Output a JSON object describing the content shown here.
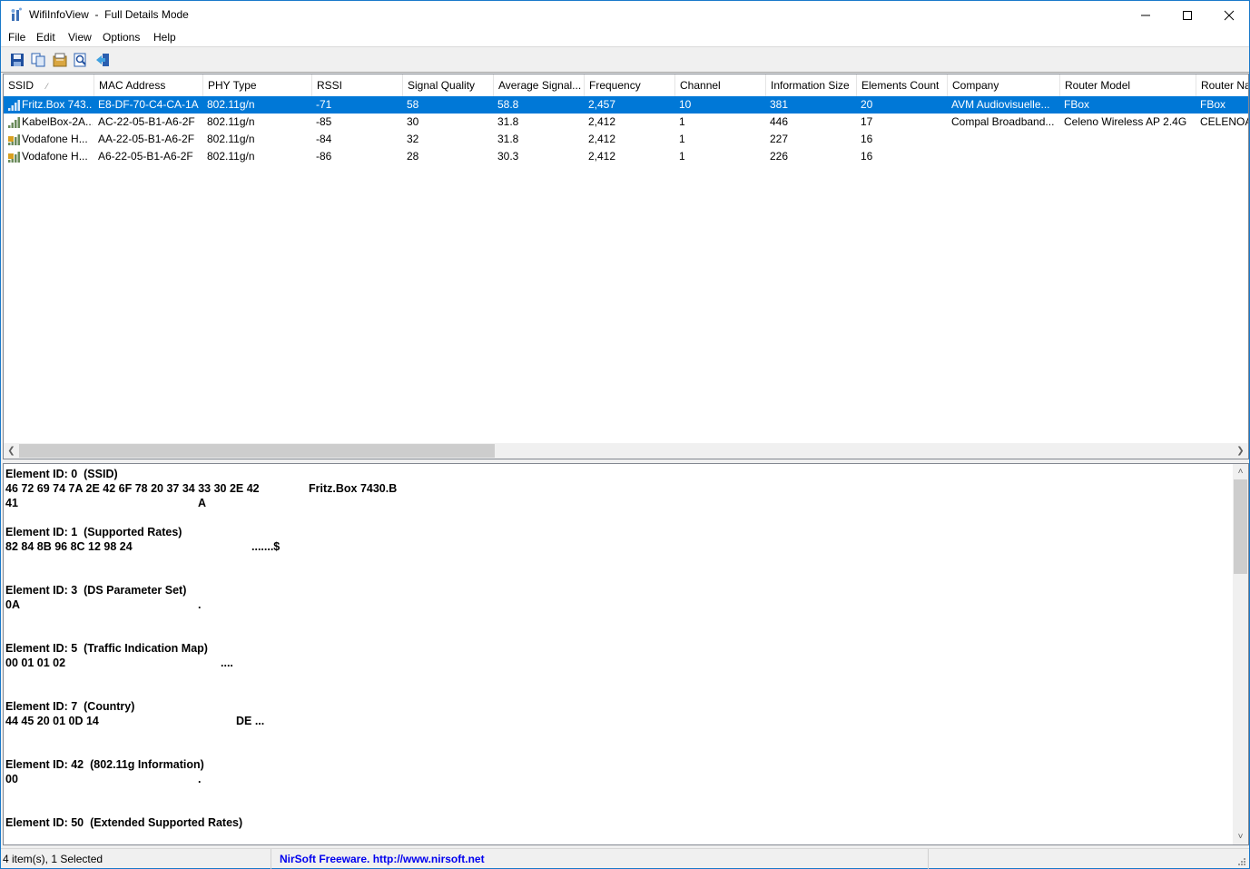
{
  "window": {
    "app_name": "WifiInfoView",
    "title_sep": "-",
    "mode": "Full Details Mode"
  },
  "menu": [
    "File",
    "Edit",
    "View",
    "Options",
    "Help"
  ],
  "toolbar": {
    "icons": [
      "save-icon",
      "copy-icon",
      "properties-icon",
      "find-icon",
      "exit-icon"
    ]
  },
  "columns": [
    "SSID",
    "MAC Address",
    "PHY Type",
    "RSSI",
    "Signal Quality",
    "Average Signal...",
    "Frequency",
    "Channel",
    "Information Size",
    "Elements Count",
    "Company",
    "Router Model",
    "Router Na"
  ],
  "rows": [
    {
      "ssid": "Fritz.Box 743...",
      "mac": "E8-DF-70-C4-CA-1A",
      "phy": "802.11g/n",
      "rssi": "-71",
      "quality": "58",
      "avg": "58.8",
      "freq": "2,457",
      "channel": "10",
      "info_size": "381",
      "elements": "20",
      "company": "AVM Audiovisuelle...",
      "model": "FBox",
      "router_name": "FBox",
      "icon": "signal-icon",
      "selected": true
    },
    {
      "ssid": "KabelBox-2A...",
      "mac": "AC-22-05-B1-A6-2F",
      "phy": "802.11g/n",
      "rssi": "-85",
      "quality": "30",
      "avg": "31.8",
      "freq": "2,412",
      "channel": "1",
      "info_size": "446",
      "elements": "17",
      "company": "Compal Broadband...",
      "model": "Celeno Wireless AP 2.4G",
      "router_name": "CELENOA",
      "icon": "signal-icon",
      "selected": false
    },
    {
      "ssid": "Vodafone H...",
      "mac": "AA-22-05-B1-A6-2F",
      "phy": "802.11g/n",
      "rssi": "-84",
      "quality": "32",
      "avg": "31.8",
      "freq": "2,412",
      "channel": "1",
      "info_size": "227",
      "elements": "16",
      "company": "",
      "model": "",
      "router_name": "",
      "icon": "locked-signal-icon",
      "selected": false
    },
    {
      "ssid": "Vodafone H...",
      "mac": "A6-22-05-B1-A6-2F",
      "phy": "802.11g/n",
      "rssi": "-86",
      "quality": "28",
      "avg": "30.3",
      "freq": "2,412",
      "channel": "1",
      "info_size": "226",
      "elements": "16",
      "company": "",
      "model": "",
      "router_name": "",
      "icon": "locked-signal-icon",
      "selected": false
    }
  ],
  "details": [
    {
      "header": "Element ID: 0  (SSID)",
      "hex": [
        "46 72 69 74 7A 2E 42 6F 78 20 37 34 33 30 2E 42",
        "41"
      ],
      "ascii": [
        "Fritz.Box 7430.B",
        "A"
      ]
    },
    {
      "header": "Element ID: 1  (Supported Rates)",
      "hex": [
        "82 84 8B 96 8C 12 98 24"
      ],
      "ascii": [
        ".......$"
      ]
    },
    {
      "header": "Element ID: 3  (DS Parameter Set)",
      "hex": [
        "0A"
      ],
      "ascii": [
        "."
      ]
    },
    {
      "header": "Element ID: 5  (Traffic Indication Map)",
      "hex": [
        "00 01 01 02"
      ],
      "ascii": [
        "...."
      ]
    },
    {
      "header": "Element ID: 7  (Country)",
      "hex": [
        "44 45 20 01 0D 14"
      ],
      "ascii": [
        "DE ..."
      ]
    },
    {
      "header": "Element ID: 42  (802.11g Information)",
      "hex": [
        "00"
      ],
      "ascii": [
        "."
      ]
    },
    {
      "header": "Element ID: 50  (Extended Supported Rates)",
      "hex": [],
      "ascii": []
    }
  ],
  "status": {
    "count": "4 item(s), 1 Selected",
    "credit": "NirSoft Freeware.  http://www.nirsoft.net"
  }
}
